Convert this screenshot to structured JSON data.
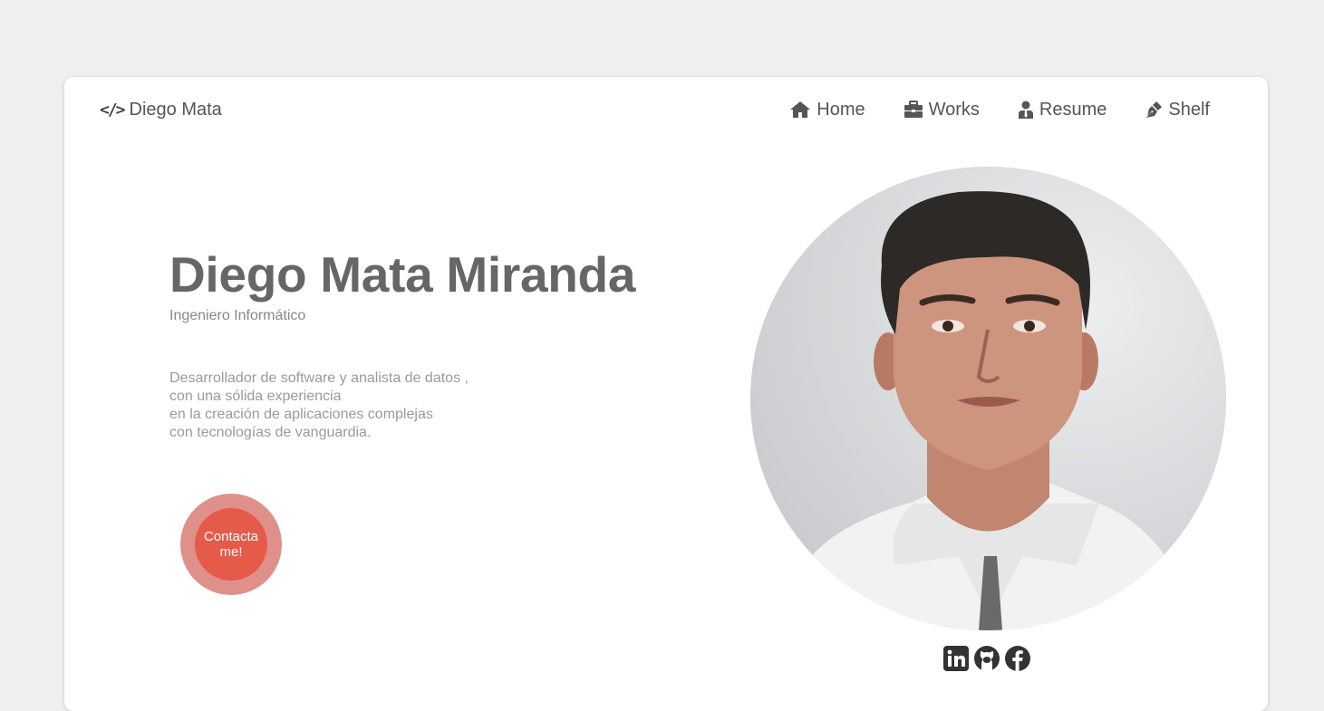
{
  "brand": {
    "icon": "code-icon",
    "name": "Diego Mata"
  },
  "nav": {
    "items": [
      {
        "label": "Home",
        "icon": "home-icon"
      },
      {
        "label": "Works",
        "icon": "briefcase-icon"
      },
      {
        "label": "Resume",
        "icon": "user-tie-icon"
      },
      {
        "label": "Shelf",
        "icon": "pen-nib-icon"
      }
    ]
  },
  "hero": {
    "name": "Diego Mata Miranda",
    "subtitle": "Ingeniero Informático",
    "description": [
      "Desarrollador de software y analista de datos ,",
      "con una sólida experiencia",
      "en la creación de aplicaciones complejas",
      "con tecnologías de vanguardia."
    ],
    "contact_label": "Contacta me!"
  },
  "socials": [
    "linkedin-icon",
    "github-icon",
    "facebook-icon"
  ],
  "colors": {
    "background": "#f0efee",
    "card": "#ffffff",
    "accent": "#e55a49",
    "accent_ring": "#e0908a",
    "text": "#666666"
  }
}
